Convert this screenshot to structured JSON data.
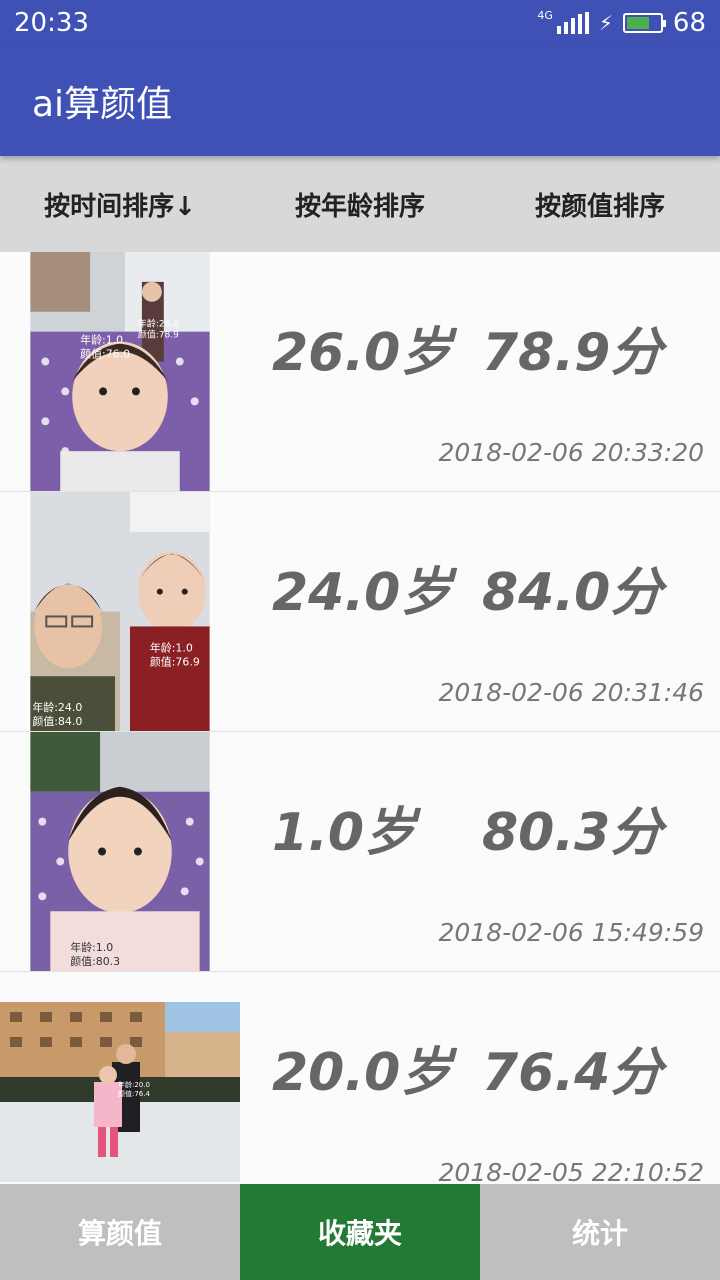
{
  "status_bar": {
    "time": "20:33",
    "network": "4G",
    "battery_level": "68",
    "battery_fraction": 0.68,
    "icons": [
      "signal-icon",
      "charging-icon",
      "battery-icon"
    ]
  },
  "app_bar": {
    "title": "ai算颜值"
  },
  "sort_tabs": [
    {
      "label": "按时间排序↓"
    },
    {
      "label": "按年龄排序"
    },
    {
      "label": "按颜值排序"
    }
  ],
  "records": [
    {
      "age": "26.0岁",
      "score": "78.9分",
      "time": "2018-02-06 20:33:20"
    },
    {
      "age": "24.0岁",
      "score": "84.0分",
      "time": "2018-02-06 20:31:46"
    },
    {
      "age": "1.0岁",
      "score": "80.3分",
      "time": "2018-02-06 15:49:59"
    },
    {
      "age": "20.0岁",
      "score": "76.4分",
      "time": "2018-02-05 22:10:52"
    }
  ],
  "photo_overlays": {
    "photo1": [
      "年龄:1.0",
      "颜值:76.0",
      "年龄:26.0",
      "颜值:78.9"
    ],
    "photo2": [
      "年龄:1.0",
      "颜值:76.9",
      "年龄:24.0",
      "颜值:84.0"
    ],
    "photo3": [
      "年龄:1.0",
      "颜值:80.3"
    ],
    "photo4": [
      "年龄:20.0",
      "颜值:76.4"
    ]
  },
  "bottom_nav": [
    {
      "label": "算颜值"
    },
    {
      "label": "收藏夹"
    },
    {
      "label": "统计"
    }
  ],
  "colors": {
    "primary": "#3f51b5",
    "active_nav": "#237a35",
    "inactive_nav": "#bfbfbf",
    "sort_bar": "#d8d8d8"
  }
}
